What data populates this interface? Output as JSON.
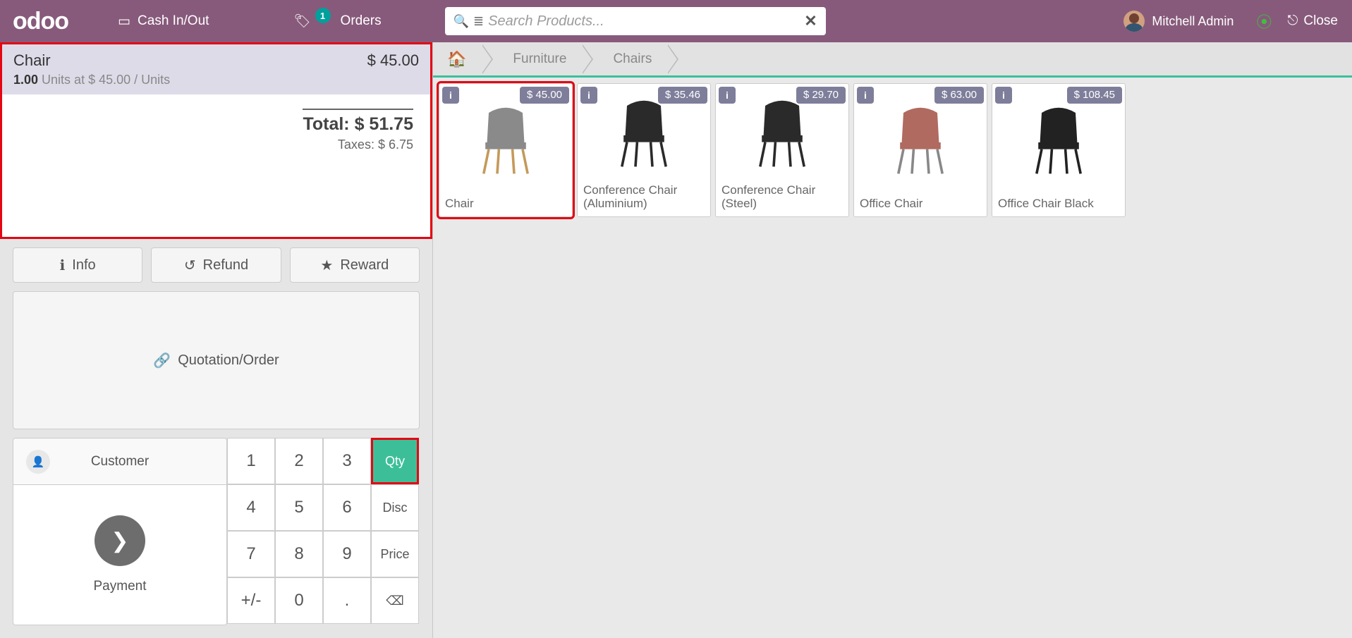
{
  "topbar": {
    "logo": "odoo",
    "cash": "Cash In/Out",
    "orders": "Orders",
    "orders_badge": "1",
    "search_placeholder": "Search Products...",
    "user": "Mitchell Admin",
    "close": "Close"
  },
  "order": {
    "line_name": "Chair",
    "line_price": "$ 45.00",
    "line_qty": "1.00",
    "line_qty_rest": " Units at $ 45.00 / Units",
    "total_label": "Total: ",
    "total_value": "$ 51.75",
    "tax_label": "Taxes: ",
    "tax_value": "$ 6.75"
  },
  "buttons": {
    "info": "Info",
    "refund": "Refund",
    "reward": "Reward",
    "quotation": "Quotation/Order",
    "customer": "Customer",
    "payment": "Payment"
  },
  "numpad": {
    "k1": "1",
    "k2": "2",
    "k3": "3",
    "qty": "Qty",
    "k4": "4",
    "k5": "5",
    "k6": "6",
    "disc": "Disc",
    "k7": "7",
    "k8": "8",
    "k9": "9",
    "price": "Price",
    "pm": "+/-",
    "k0": "0",
    "dot": ".",
    "bs": "⌫"
  },
  "breadcrumb": {
    "b1": "Furniture",
    "b2": "Chairs"
  },
  "products": [
    {
      "name": "Chair",
      "price": "$ 45.00",
      "sel": true,
      "fill": "#8a8a8a",
      "legs": "#c49a5a"
    },
    {
      "name": "Conference Chair (Aluminium)",
      "price": "$ 35.46",
      "sel": false,
      "fill": "#2a2a2a",
      "legs": "#2a2a2a"
    },
    {
      "name": "Conference Chair (Steel)",
      "price": "$ 29.70",
      "sel": false,
      "fill": "#2a2a2a",
      "legs": "#2a2a2a"
    },
    {
      "name": "Office Chair",
      "price": "$ 63.00",
      "sel": false,
      "fill": "#b06a60",
      "legs": "#888"
    },
    {
      "name": "Office Chair Black",
      "price": "$ 108.45",
      "sel": false,
      "fill": "#222",
      "legs": "#222"
    }
  ]
}
